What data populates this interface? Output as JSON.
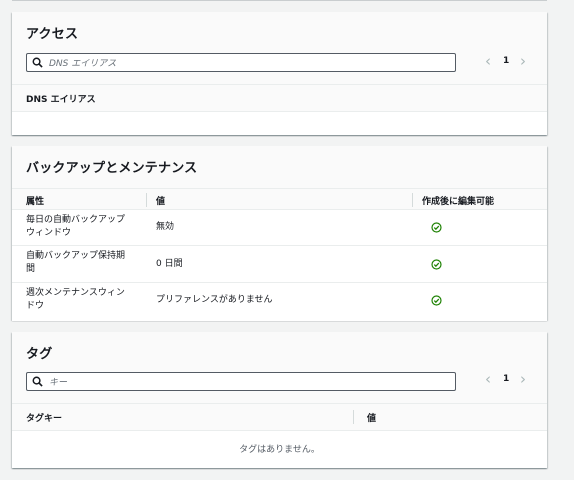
{
  "access": {
    "title": "アクセス",
    "search_placeholder": "DNS エイリアス",
    "page": "1",
    "column": "DNS エイリアス"
  },
  "backup": {
    "title": "バックアップとメンテナンス",
    "columns": [
      "属性",
      "値",
      "作成後に編集可能"
    ],
    "rows": [
      {
        "attr_line1": "毎日の自動バックアップ",
        "attr_line2": "ウィンドウ",
        "value": "無効",
        "editable_icon": "check-circle-icon"
      },
      {
        "attr_line1": "自動バックアップ保持期",
        "attr_line2": "間",
        "value": "0 日間",
        "editable_icon": "check-circle-icon"
      },
      {
        "attr_line1": "週次メンテナンスウィン",
        "attr_line2": "ドウ",
        "value": "プリファレンスがありません",
        "editable_icon": "check-circle-icon"
      }
    ],
    "check_color": "#1d8102"
  },
  "tags": {
    "title": "タグ",
    "search_placeholder": "キー",
    "page": "1",
    "columns": [
      "タグキー",
      "値"
    ],
    "empty_text": "タグはありません。"
  }
}
